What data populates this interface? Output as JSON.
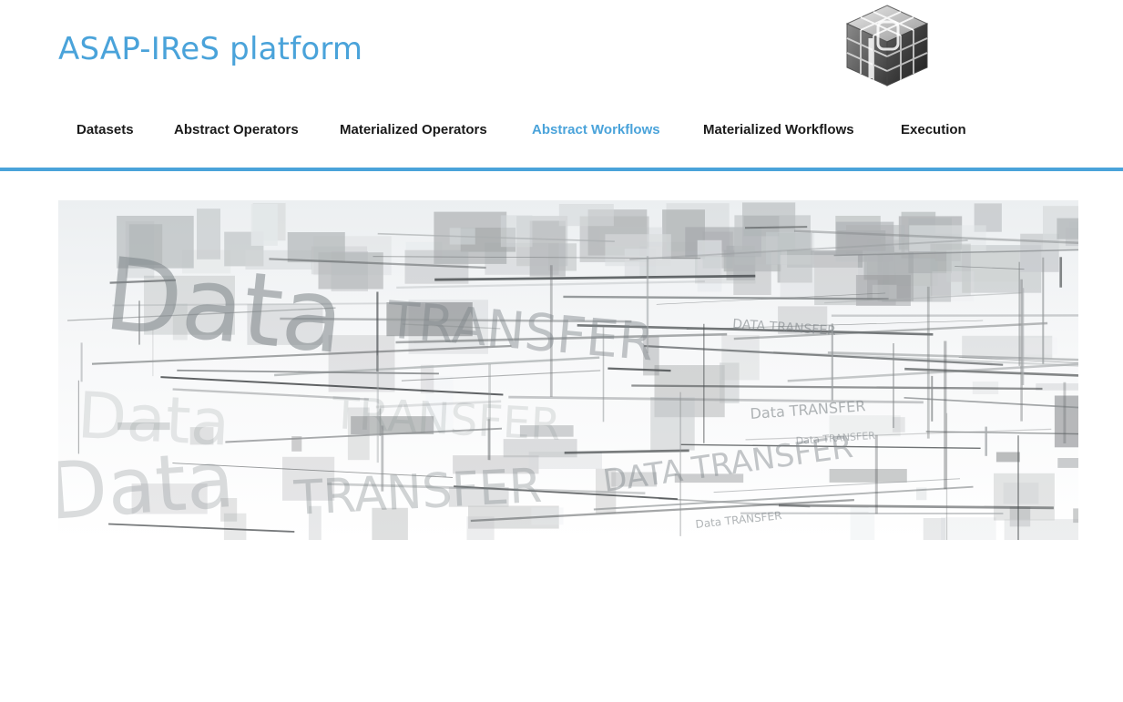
{
  "header": {
    "site_title": "ASAP-IReS platform",
    "logo": "cube-logo-icon"
  },
  "nav": {
    "items": [
      {
        "label": "Datasets",
        "active": false
      },
      {
        "label": "Abstract Operators",
        "active": false
      },
      {
        "label": "Materialized Operators",
        "active": false
      },
      {
        "label": "Abstract Workflows",
        "active": true
      },
      {
        "label": "Materialized Workflows",
        "active": false
      },
      {
        "label": "Execution",
        "active": false
      }
    ]
  },
  "banner": {
    "image": "data-transfer-abstract-banner",
    "overlay_words": [
      "Data",
      "TRANSFER",
      "DATA TRANSFER",
      "Data",
      "TRANSFER",
      "Data TRANSFER",
      "Data",
      "TRANSFER",
      "DATA TRANSFER",
      "Data TRANSFER",
      "Data TRANSFER",
      "data",
      "TRANSFER",
      "Data",
      "TRANSFER",
      "Data TRANSFER",
      "Data transfer"
    ]
  },
  "colors": {
    "accent": "#4aa3da",
    "nav_text": "#1a1a1a"
  }
}
